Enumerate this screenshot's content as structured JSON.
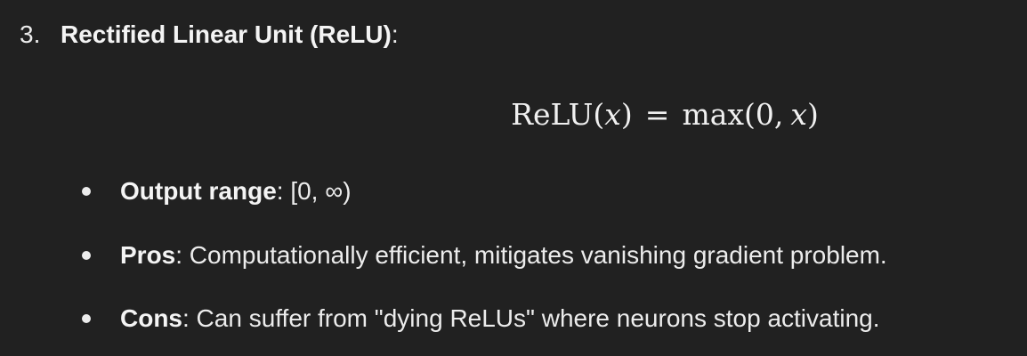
{
  "item": {
    "number": "3.",
    "title": "Rectified Linear Unit (ReLU)",
    "title_suffix": ":"
  },
  "formula": {
    "lhs_func": "ReLU",
    "lhs_open": "(",
    "lhs_var": "x",
    "lhs_close": ")",
    "equals": "=",
    "rhs_func": "max",
    "rhs_open": "(0,",
    "rhs_var": "x",
    "rhs_close": ")"
  },
  "bullets": [
    {
      "label": "Output range",
      "separator": ":",
      "text": " [0, ∞)"
    },
    {
      "label": "Pros",
      "separator": ":",
      "text": " Computationally efficient, mitigates vanishing gradient problem."
    },
    {
      "label": "Cons",
      "separator": ":",
      "text": " Can suffer from \"dying ReLUs\" where neurons stop activating."
    }
  ]
}
